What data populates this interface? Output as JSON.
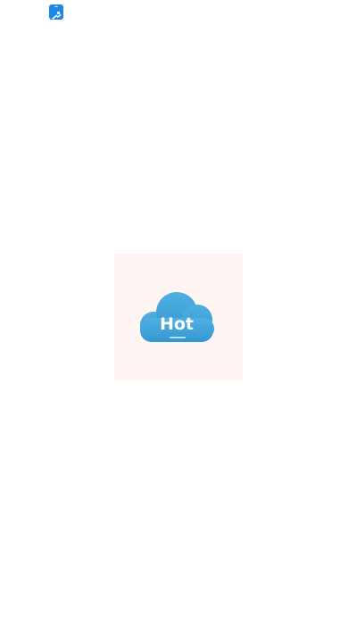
{
  "splash": {
    "logo_word": "Hot"
  },
  "colors": {
    "background": "#ffffff",
    "tile_background": "#fff6f4",
    "cloud_fill": "#3fa3da",
    "cloud_text": "#ffffff",
    "status_icon": "#1e88e5"
  },
  "status_bar": {
    "app_icon": "app-notification-icon"
  }
}
